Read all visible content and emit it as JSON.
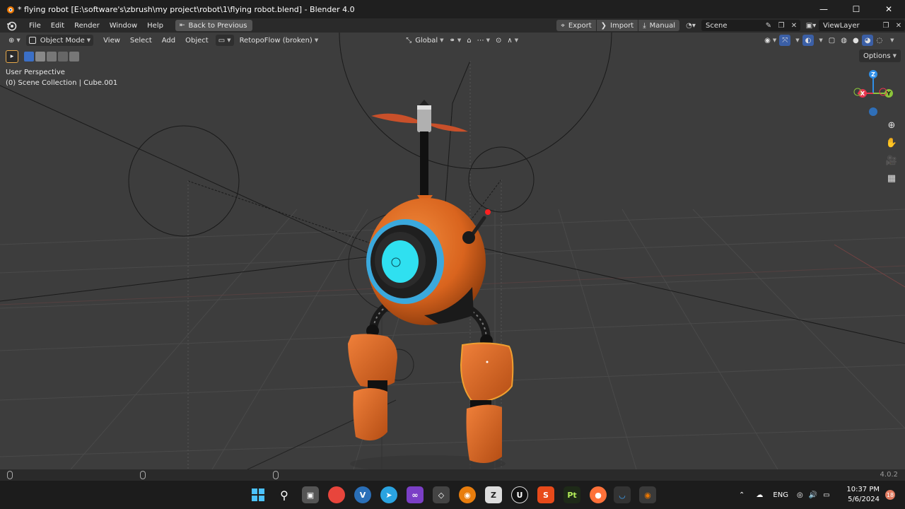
{
  "window": {
    "title": "* flying robot [E:\\software's\\zbrush\\my project\\robot\\1\\flying robot.blend] - Blender 4.0",
    "minimize": "—",
    "maximize": "☐",
    "close": "✕"
  },
  "menubar": {
    "items": [
      "File",
      "Edit",
      "Render",
      "Window",
      "Help"
    ],
    "back_button": "Back to Previous",
    "export": "Export",
    "import": "Import",
    "manual": "Manual",
    "scene": "Scene",
    "view_layer": "ViewLayer"
  },
  "viewport_header": {
    "mode": "Object Mode",
    "menus": [
      "View",
      "Select",
      "Add",
      "Object"
    ],
    "addon": "RetopoFlow (broken)",
    "transform_orientation": "Global",
    "options": "Options"
  },
  "viewport": {
    "perspective": "User Perspective",
    "collection": "(0) Scene Collection | Cube.001",
    "gizmo_axes": [
      "Z",
      "X",
      "Y"
    ]
  },
  "statusbar": {
    "version": "4.0.2"
  },
  "taskbar": {
    "language": "ENG",
    "time": "10:37 PM",
    "date": "5/6/2024",
    "notifications": "18"
  },
  "colors": {
    "robot_orange": "#d9641e",
    "eye_cyan": "#2fe0f0",
    "eye_ring": "#3ba9dd",
    "selection": "#f0a030",
    "axis_x": "#e8364f",
    "axis_y": "#8bc43a",
    "axis_z": "#2f8fe8"
  }
}
